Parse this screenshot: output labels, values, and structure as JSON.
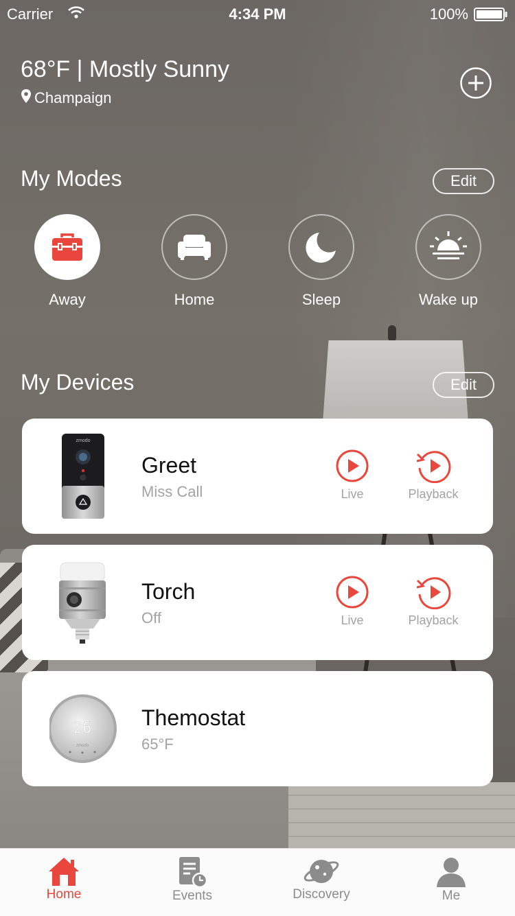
{
  "status_bar": {
    "carrier": "Carrier",
    "time": "4:34 PM",
    "battery": "100%"
  },
  "weather": {
    "temp_condition": "68°F | Mostly Sunny",
    "location": "Champaign"
  },
  "modes": {
    "title": "My Modes",
    "edit_label": "Edit",
    "items": [
      {
        "label": "Away",
        "icon": "toolbox-icon",
        "active": true
      },
      {
        "label": "Home",
        "icon": "sofa-icon",
        "active": false
      },
      {
        "label": "Sleep",
        "icon": "moon-icon",
        "active": false
      },
      {
        "label": "Wake up",
        "icon": "sunrise-icon",
        "active": false
      }
    ]
  },
  "devices": {
    "title": "My Devices",
    "edit_label": "Edit",
    "items": [
      {
        "name": "Greet",
        "status": "Miss Call",
        "live_label": "Live",
        "playback_label": "Playback",
        "thumb_text": "zmodo"
      },
      {
        "name": "Torch",
        "status": "Off",
        "live_label": "Live",
        "playback_label": "Playback"
      },
      {
        "name": "Themostat",
        "status": "65°F",
        "thumb_text": "26",
        "brand": "zmodo"
      }
    ]
  },
  "tabs": [
    {
      "label": "Home",
      "icon": "house-icon",
      "active": true
    },
    {
      "label": "Events",
      "icon": "events-icon",
      "active": false
    },
    {
      "label": "Discovery",
      "icon": "planet-icon",
      "active": false
    },
    {
      "label": "Me",
      "icon": "person-icon",
      "active": false
    }
  ],
  "colors": {
    "accent": "#e9473d",
    "card": "#ffffff",
    "muted_text": "#a3a3a3"
  }
}
